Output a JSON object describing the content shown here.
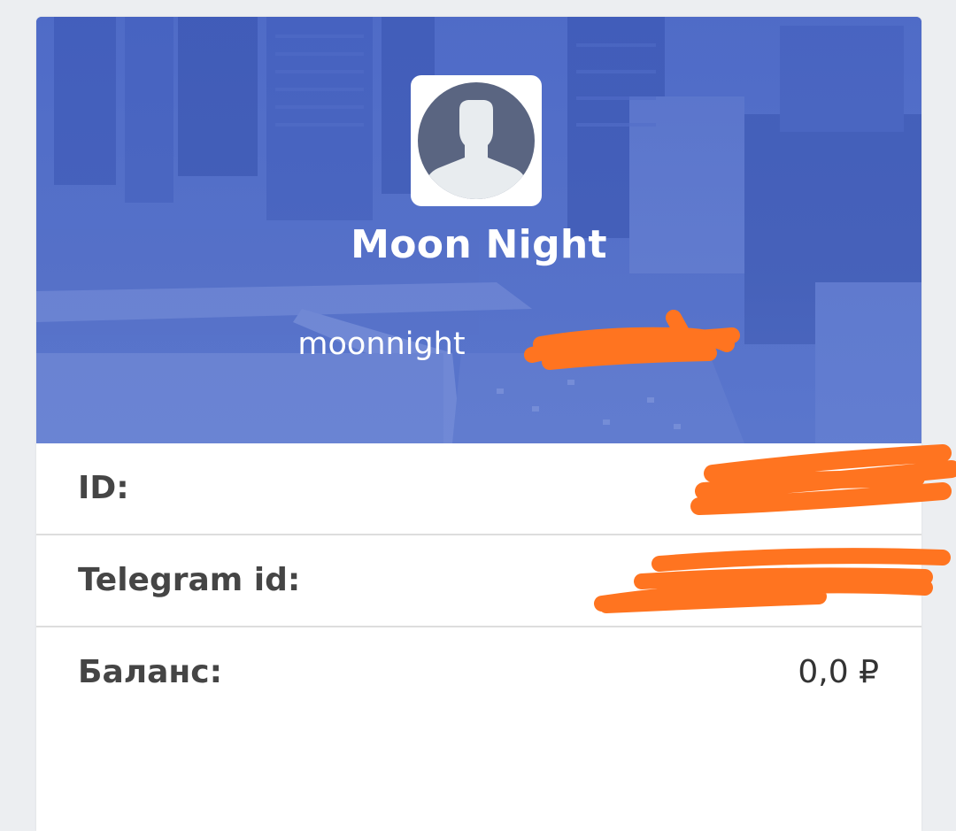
{
  "profile": {
    "name": "Moon Night",
    "username": "moonnight"
  },
  "details": {
    "id_label": "ID:",
    "telegram_label": "Telegram id:",
    "balance_label": "Баланс:",
    "balance_value": "0,0 ₽"
  },
  "icons": {
    "avatar": "user-silhouette-icon"
  },
  "colors": {
    "banner": "#4a66c4",
    "redaction": "#ff7420",
    "label_text": "#454545",
    "page_background": "#eceef1"
  }
}
